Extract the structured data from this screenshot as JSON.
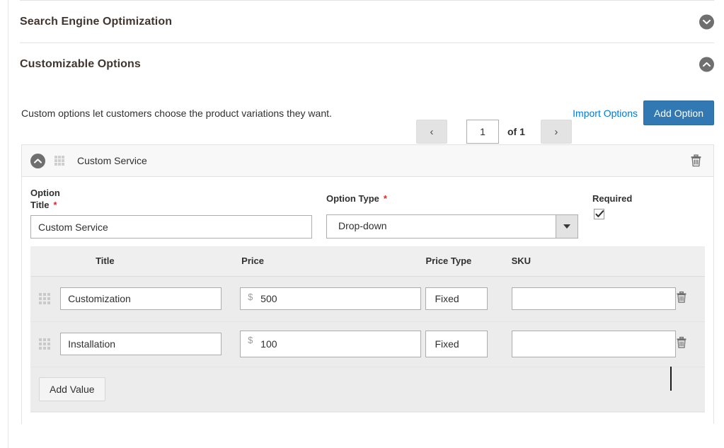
{
  "sections": [
    {
      "id": "seo",
      "title": "Search Engine Optimization",
      "toggle_icon": "chevron-down-icon",
      "expanded": false
    },
    {
      "id": "customizable_options",
      "title": "Customizable Options",
      "toggle_icon": "chevron-up-icon",
      "expanded": true
    }
  ],
  "customizable_options": {
    "description": "Custom options let customers choose the product variations they want.",
    "pager": {
      "prev_label": "‹",
      "page_value": "1",
      "of_label": "of 1",
      "next_label": "›"
    },
    "import_options_label": "Import Options",
    "add_option_label": "Add Option",
    "accent_color": "#3278b3",
    "link_color": "#007bdb",
    "option": {
      "header_title": "Custom Service",
      "collapse_icon": "chevron-up-icon",
      "drag_icon": "drag-handle-icon",
      "delete_icon": "trash-icon",
      "fields": {
        "title_label": "Option Title",
        "title_label_line1": "Option",
        "title_label_line2": "Title",
        "title_required_mark": "*",
        "title_value": "Custom Service",
        "type_label": "Option Type",
        "type_required_mark": "*",
        "type_value": "Drop-down",
        "required_label": "Required",
        "required_checked": true
      },
      "values_table": {
        "columns": [
          "Title",
          "Price",
          "Price Type",
          "SKU"
        ],
        "rows": [
          {
            "title": "Customization",
            "price_symbol": "$",
            "price": "500",
            "price_type": "Fixed",
            "sku": ""
          },
          {
            "title": "Installation",
            "price_symbol": "$",
            "price": "100",
            "price_type": "Fixed",
            "sku": ""
          }
        ],
        "add_value_label": "Add Value"
      }
    }
  }
}
